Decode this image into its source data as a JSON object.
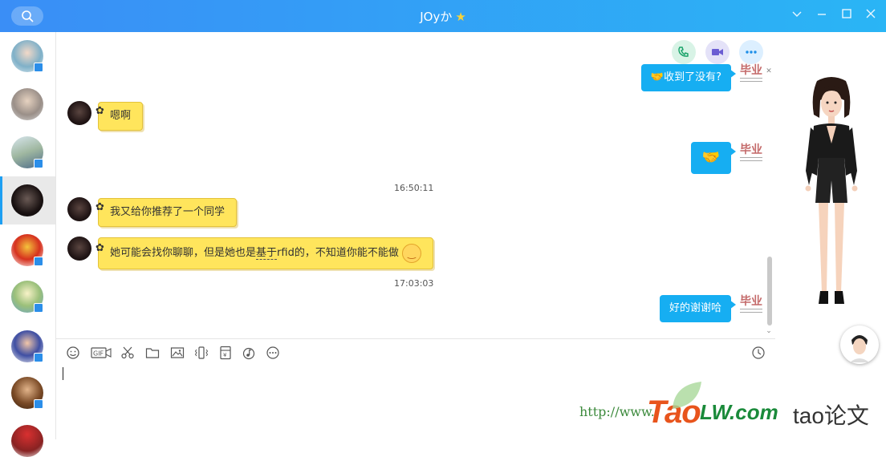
{
  "window": {
    "title": "JOyか",
    "title_icon": "star-emoji"
  },
  "messages": [
    {
      "side": "right",
      "text": "收到了没有?",
      "emoji": "handshake"
    },
    {
      "side": "left",
      "text": "嗯啊"
    },
    {
      "side": "right",
      "text": "",
      "emoji": "handshake"
    },
    {
      "type": "time",
      "text": "16:50:11"
    },
    {
      "side": "left",
      "text": "我又给你推荐了一个同学"
    },
    {
      "side": "left",
      "text_a": "她可能会找你聊聊，但是她也是",
      "text_b": "基于",
      "text_c": "rfid的，不知道你能不能做",
      "emoji": "smile"
    },
    {
      "type": "time",
      "text": "17:03:03"
    },
    {
      "side": "right",
      "text": "好的谢谢哈"
    }
  ],
  "stamp_text": "毕业",
  "toolbar": [
    "emoji-icon",
    "gif-icon",
    "scissors-icon",
    "folder-icon",
    "image-icon",
    "shake-icon",
    "red-packet-icon",
    "music-icon",
    "more-icon",
    "history-icon"
  ],
  "watermark": {
    "url": "http://www.",
    "logo_a": "Tao",
    "logo_b": "LW.com",
    "logo_c": "tao论文"
  },
  "colors": {
    "title_gradient_start": "#3a8ef6",
    "title_gradient_end": "#2ab5f5",
    "bubble_self": "#16aef2",
    "bubble_other": "#ffe55c"
  }
}
